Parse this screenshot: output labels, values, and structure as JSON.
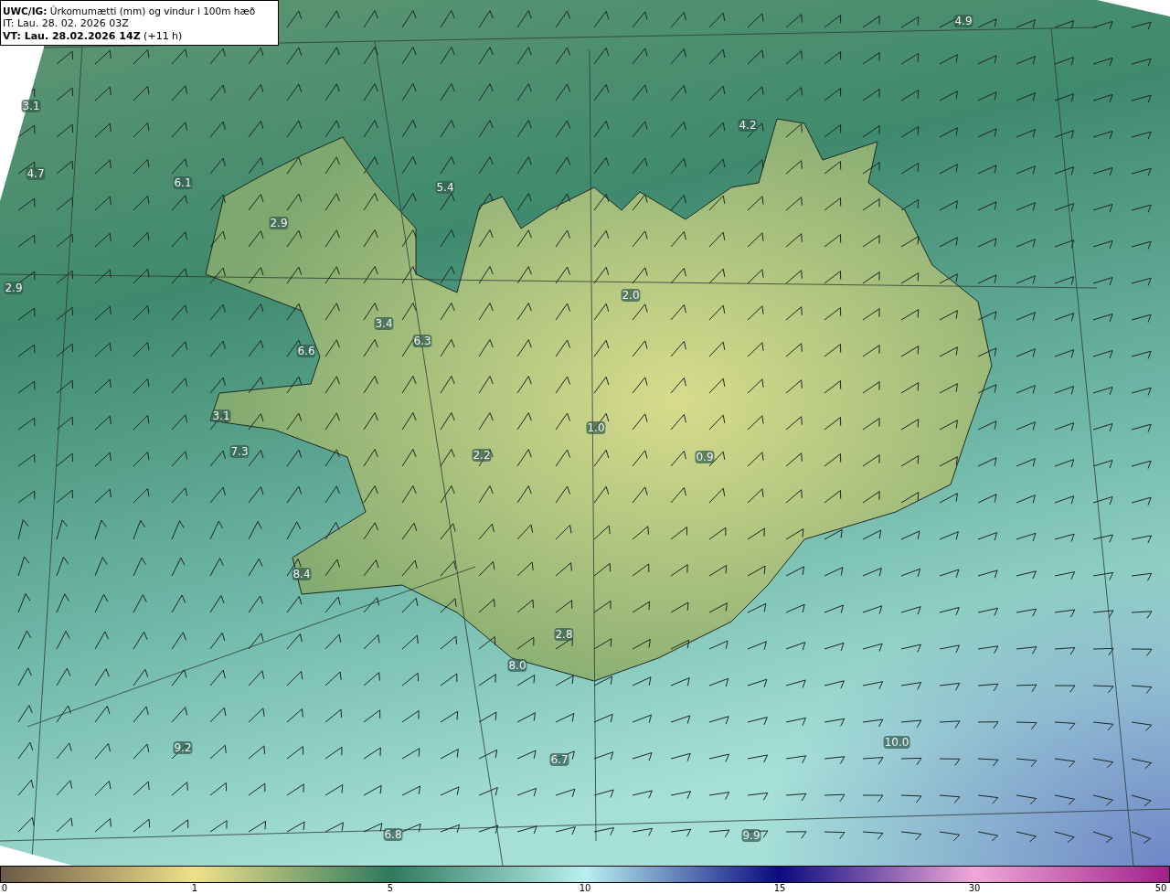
{
  "header": {
    "title": "**UWC/IG:** Úrkomumætti (mm) og vindur i 100m hæð",
    "init_time": "IT: Lau. 28. 02. 2026 03Z",
    "valid_time": "**VT: Lau. 28.02.2026 14Z** (+11 h)"
  },
  "map": {
    "labels": [
      "4.9",
      "3.1",
      "4.7",
      "6.1",
      "5.4",
      "4.2",
      "2.9",
      "2.9",
      "2.0",
      "3.4",
      "6.3",
      "6.6",
      "3.1",
      "7.3",
      "1.0",
      "2.2",
      "0.9",
      "8.4",
      "2.8",
      "8.0",
      "9.2",
      "6.7",
      "10.0",
      "6.8",
      "9.9"
    ]
  },
  "colorbar": {
    "ticks": [
      "0",
      "1",
      "5",
      "10",
      "15",
      "30",
      "50"
    ]
  }
}
